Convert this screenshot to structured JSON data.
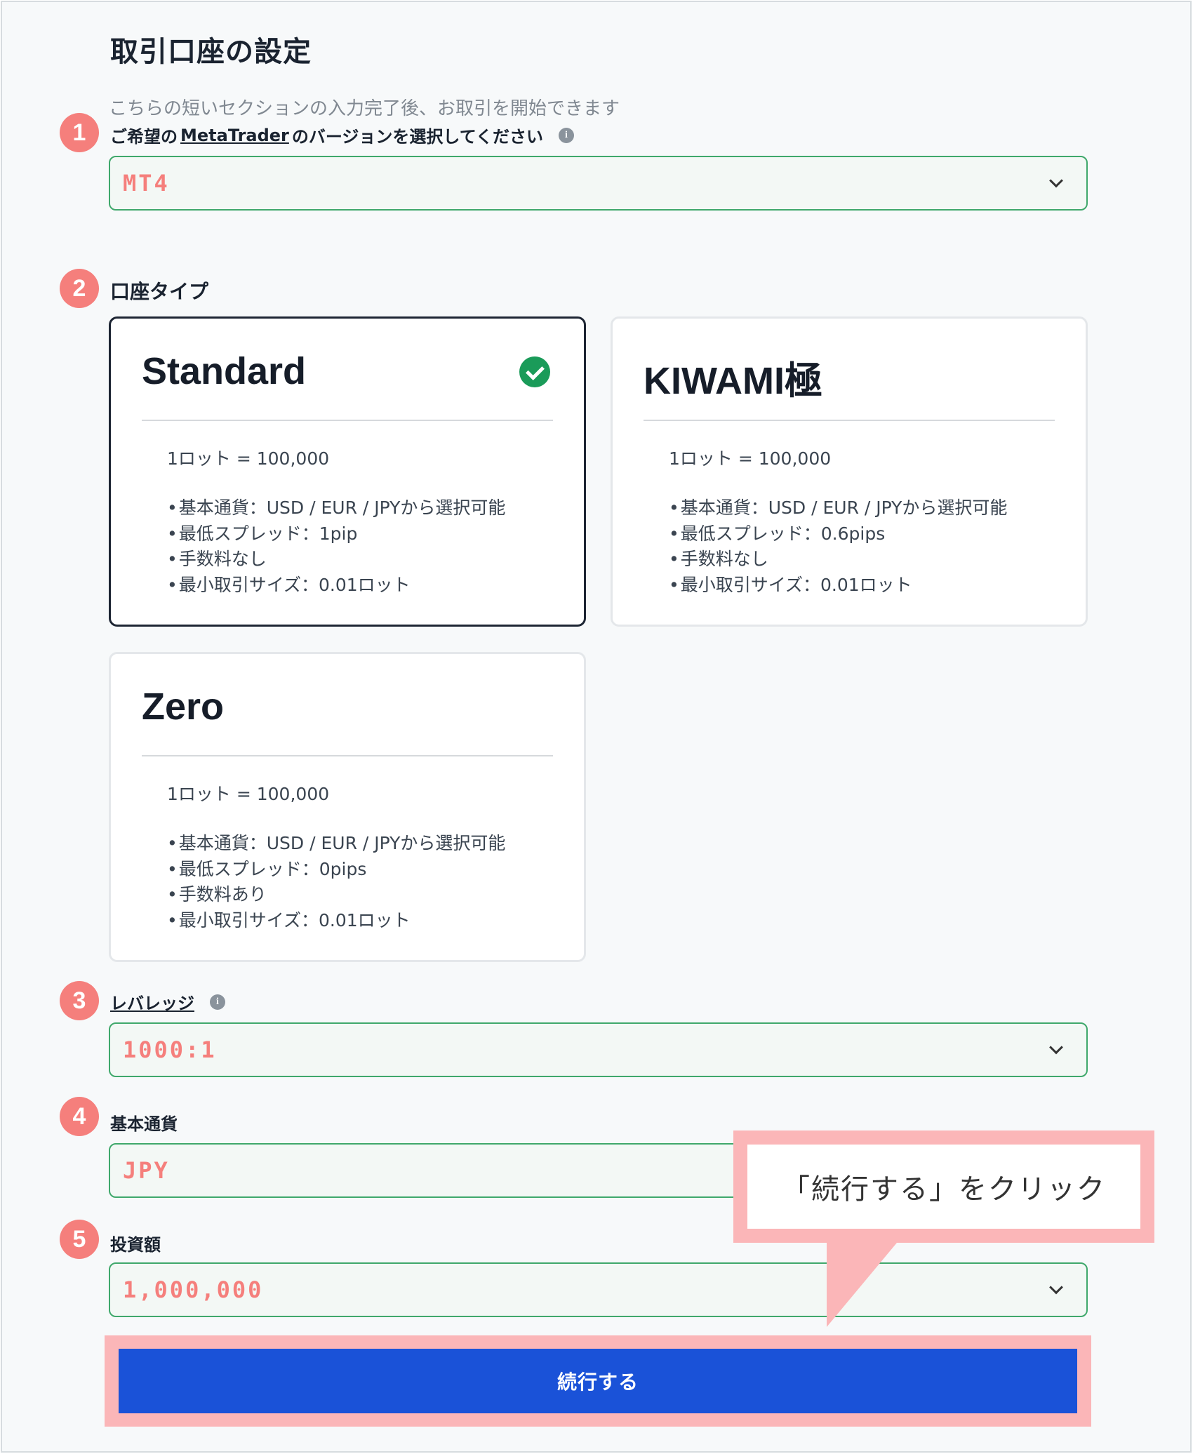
{
  "page": {
    "title": "取引口座の設定",
    "subtitle": "こちらの短いセクションの入力完了後、お取引を開始できます"
  },
  "steps": {
    "s1": "1",
    "s2": "2",
    "s3": "3",
    "s4": "4",
    "s5": "5"
  },
  "platform": {
    "label_pre": "ご希望の",
    "label_link": "MetaTrader",
    "label_post": "のバージョンを選択してください",
    "value": "MT4"
  },
  "account_type": {
    "label": "口座タイプ",
    "cards": [
      {
        "name": "Standard",
        "selected": true,
        "lot": "1ロット = 100,000",
        "features": [
          "基本通貨：USD / EUR / JPYから選択可能",
          "最低スプレッド：1pip",
          "手数料なし",
          "最小取引サイズ：0.01ロット"
        ]
      },
      {
        "name": "KIWAMI極",
        "selected": false,
        "lot": "1ロット = 100,000",
        "features": [
          "基本通貨：USD / EUR / JPYから選択可能",
          "最低スプレッド：0.6pips",
          "手数料なし",
          "最小取引サイズ：0.01ロット"
        ]
      },
      {
        "name": "Zero",
        "selected": false,
        "lot": "1ロット = 100,000",
        "features": [
          "基本通貨：USD / EUR / JPYから選択可能",
          "最低スプレッド：0pips",
          "手数料あり",
          "最小取引サイズ：0.01ロット"
        ]
      }
    ]
  },
  "leverage": {
    "label": "レバレッジ",
    "value": "1000:1"
  },
  "currency": {
    "label": "基本通貨",
    "value": "JPY"
  },
  "investment": {
    "label": "投資額",
    "value": "1,000,000"
  },
  "callout": {
    "text": "「続行する」をクリック"
  },
  "continue_label": "続行する",
  "colors": {
    "accent_pink": "#f57f7c",
    "highlight_pink": "#fbb6b8",
    "field_border": "#3fa86b",
    "button_blue": "#1a52d8",
    "check_green": "#1a9b59"
  },
  "icons": [
    "info-icon",
    "chevron-down-icon",
    "check-circle-icon"
  ]
}
